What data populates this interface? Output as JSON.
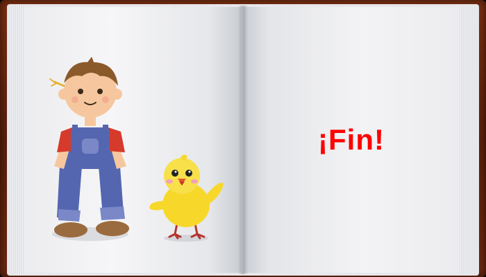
{
  "page_right": {
    "text": "¡Fin!"
  },
  "colors": {
    "cover": "#6c2810",
    "page": "#f3f3f5",
    "fin_text": "#ff0000"
  },
  "illustration": {
    "characters": [
      "boy-in-overalls",
      "yellow-chick"
    ]
  }
}
